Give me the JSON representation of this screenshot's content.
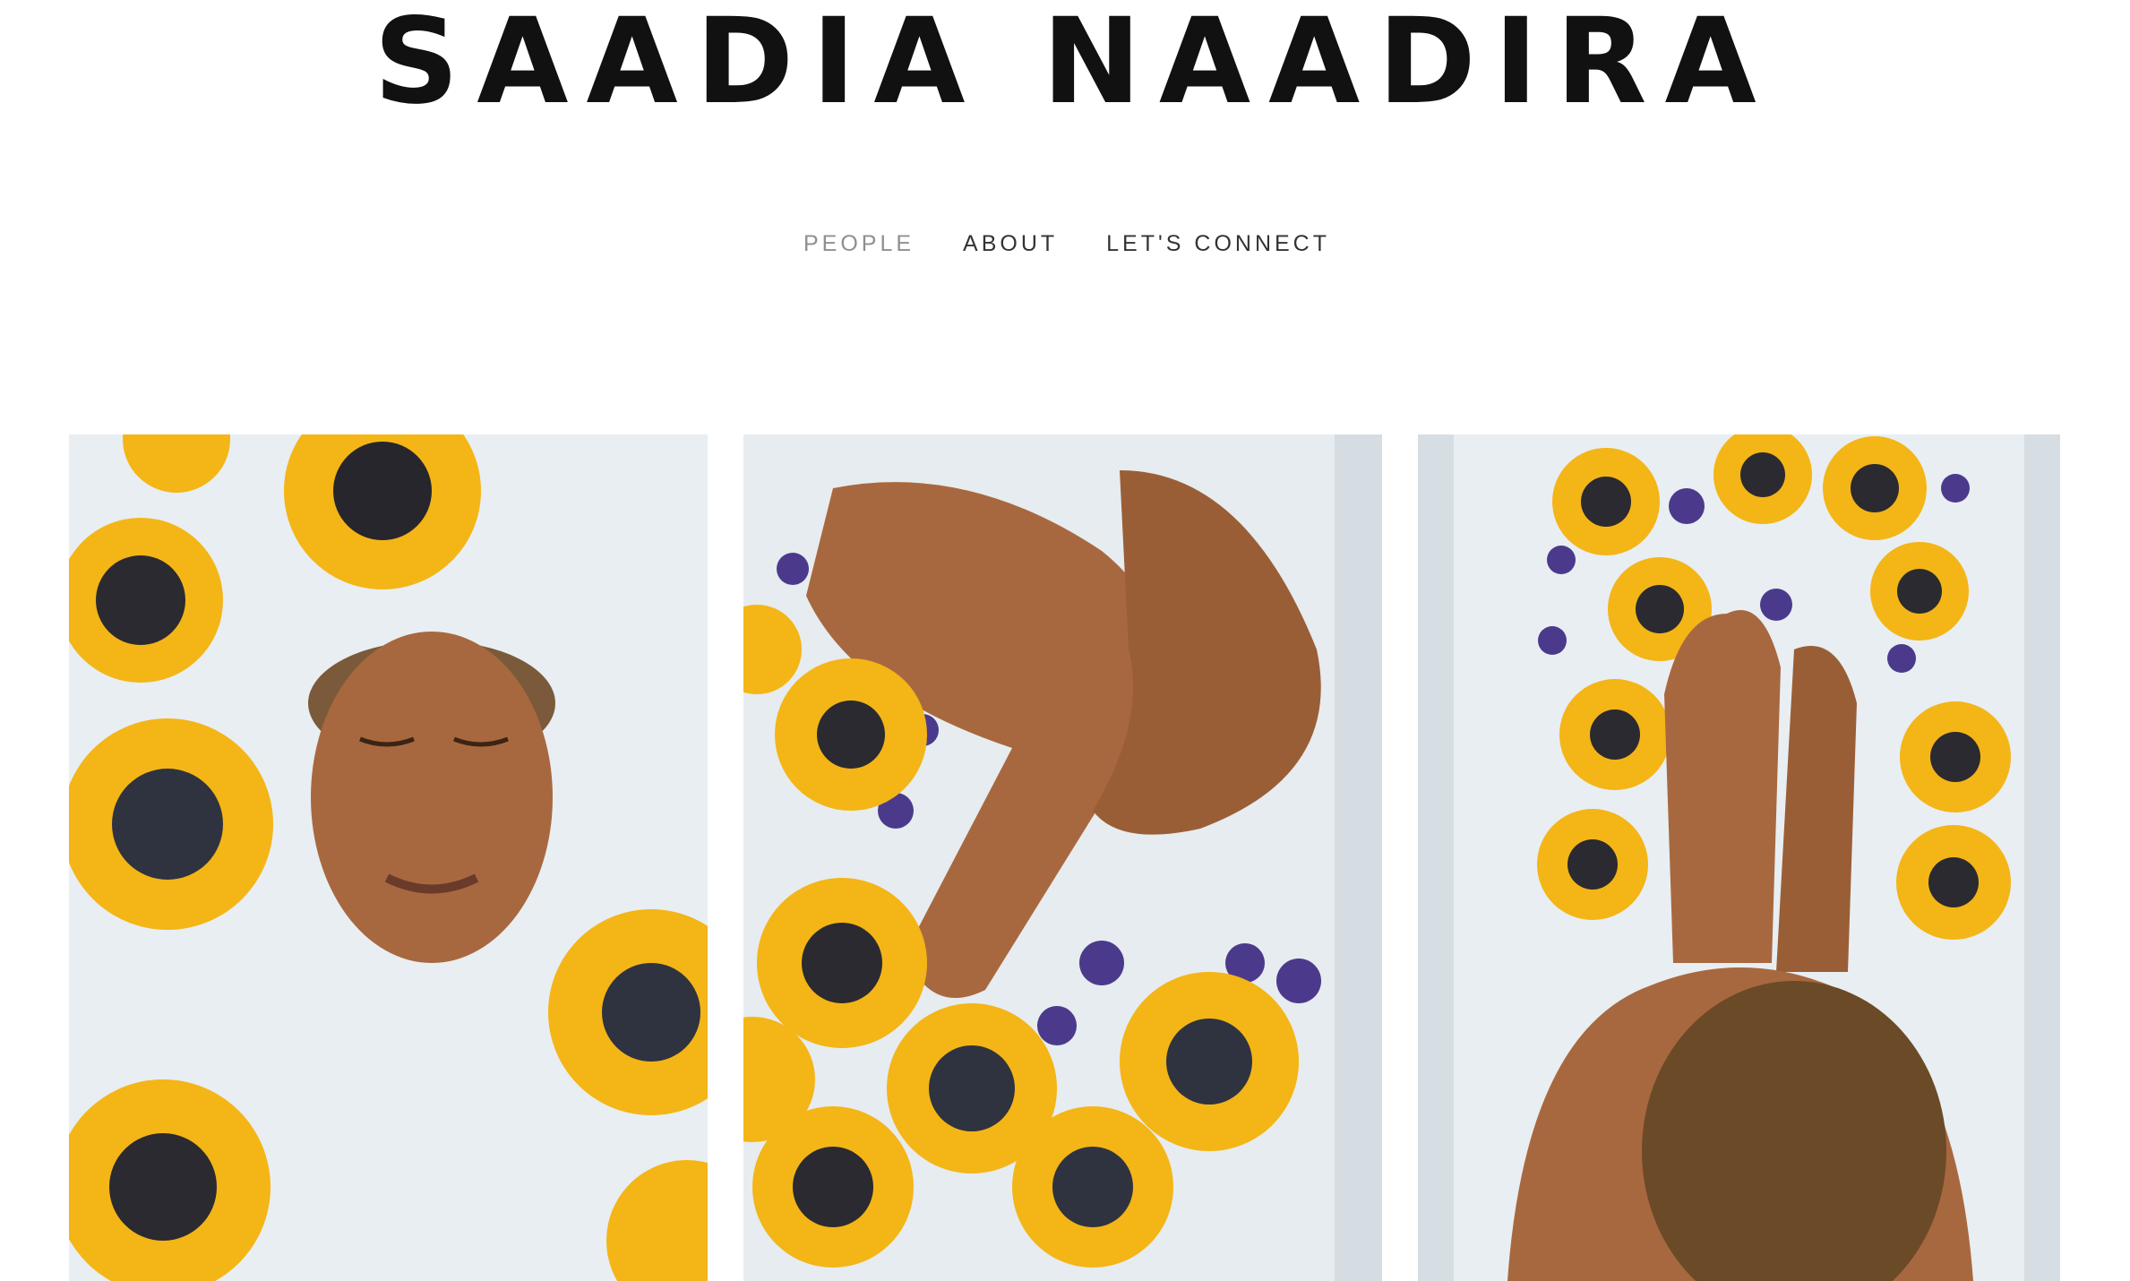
{
  "site": {
    "title": "SAADIA NAADIRA"
  },
  "nav": {
    "items": [
      {
        "label": "PEOPLE",
        "active": true
      },
      {
        "label": "ABOUT",
        "active": false
      },
      {
        "label": "LET'S CONNECT",
        "active": false
      }
    ]
  },
  "gallery": {
    "images": [
      {
        "subject": "face-in-milk-bath-with-sunflowers"
      },
      {
        "subject": "legs-in-milk-bath-with-sunflowers-and-lavender"
      },
      {
        "subject": "person-seated-in-milk-bath-with-sunflowers"
      }
    ]
  },
  "colors": {
    "text": "#111111",
    "nav_text": "#333333",
    "nav_active": "#8f8f8f",
    "milk": "#e9eff3",
    "sunflower": "#f4b516",
    "sunflower_center": "#2a2a30",
    "skin": "#a8683f",
    "lavender": "#4b3a8c"
  }
}
